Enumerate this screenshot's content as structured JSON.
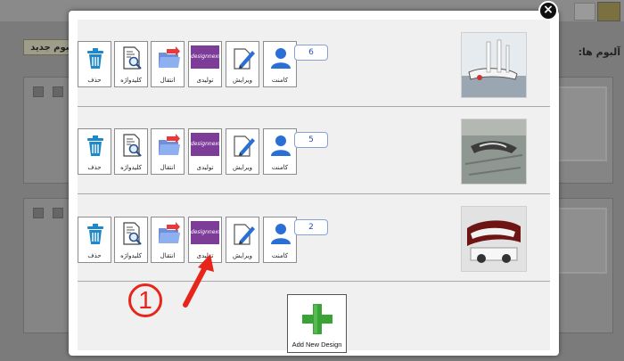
{
  "background": {
    "new_album_label": "البوم جديد",
    "albums_label": "آلبوم ها:"
  },
  "modal": {
    "close_glyph": "×",
    "rows": [
      {
        "count": "6",
        "buttons": {
          "comment": "کامنت",
          "edit": "ویرایش",
          "production": "تولیدی",
          "designnext": "designnext",
          "transfer": "انتقال",
          "keywords": "کلیدواژه",
          "delete": "حذف"
        }
      },
      {
        "count": "5",
        "buttons": {
          "comment": "کامنت",
          "edit": "ویرایش",
          "production": "تولیدی",
          "designnext": "designnext",
          "transfer": "انتقال",
          "keywords": "کلیدواژه",
          "delete": "حذف"
        }
      },
      {
        "count": "2",
        "buttons": {
          "comment": "کامنت",
          "edit": "ویرایش",
          "production": "تولیدی",
          "designnext": "designnext",
          "transfer": "انتقال",
          "keywords": "کلیدواژه",
          "delete": "حذف"
        }
      }
    ],
    "add_new_design_label": "Add New Design"
  },
  "annotation": {
    "step_number": "1",
    "color": "#e8251a"
  },
  "colors": {
    "user_icon_blue": "#2a6fd6",
    "designnext_purple": "#7d3c98",
    "plus_green": "#3aa335",
    "trash_blue": "#1e88c8"
  }
}
